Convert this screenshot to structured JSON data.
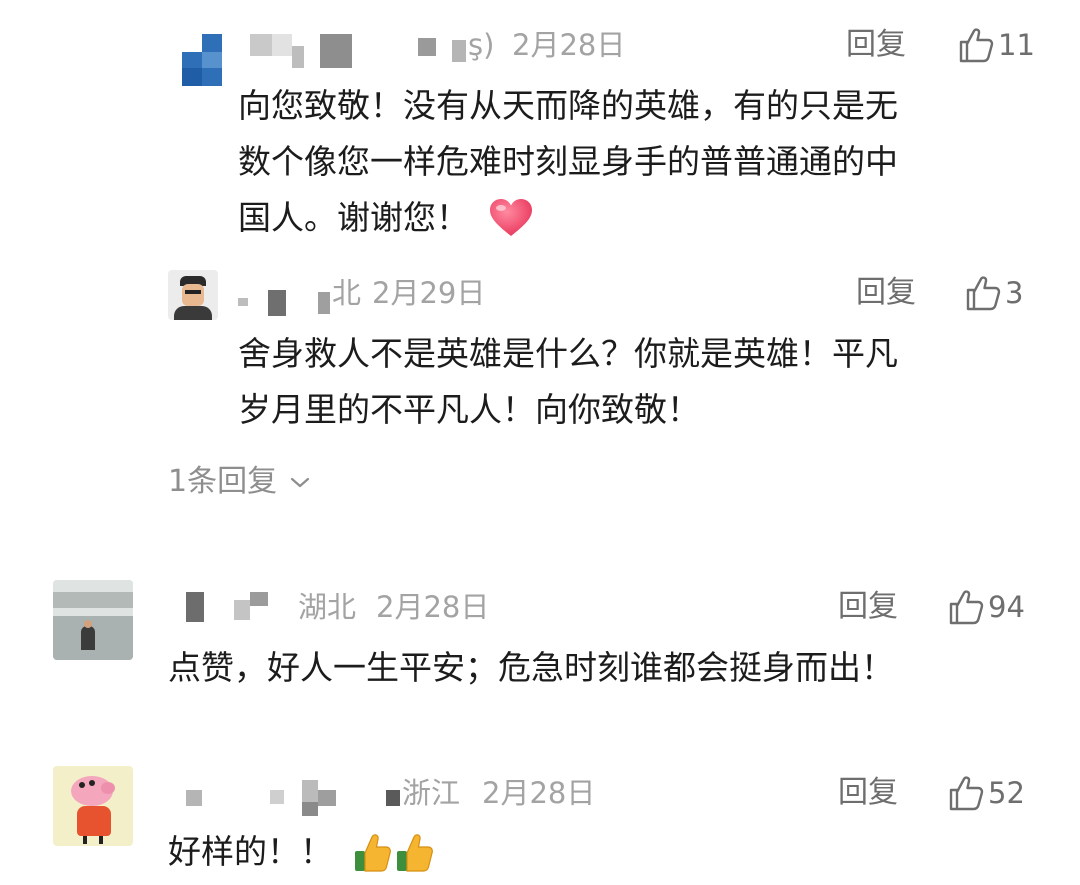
{
  "colors": {
    "text_primary": "#1c1c1c",
    "text_meta": "#a3a3a3",
    "text_action": "#6e6e6e",
    "heart": "#f0536f",
    "thumb_emoji": "#f6b530"
  },
  "comments": [
    {
      "level": "reply",
      "name_partial": "ş)",
      "location": "",
      "date": "2月28日",
      "reply_label": "回复",
      "likes": "11",
      "lines": [
        "向您致敬！没有从天而降的英雄，有的只是无",
        "数个像您一样危难时刻显身手的普普通通的中",
        "国人。谢谢您！"
      ],
      "emoji": "heart-emoji"
    },
    {
      "level": "reply",
      "name_partial": "北",
      "location": "",
      "date": "2月29日",
      "reply_label": "回复",
      "likes": "3",
      "lines": [
        "舍身救人不是英雄是什么？你就是英雄！平凡",
        "岁月里的不平凡人！向你致敬！"
      ]
    },
    {
      "level": "top",
      "name_partial": "",
      "location": "湖北",
      "date": "2月28日",
      "reply_label": "回复",
      "likes": "94",
      "lines": [
        "点赞，好人一生平安；危急时刻谁都会挺身而出！"
      ]
    },
    {
      "level": "top",
      "name_partial": "",
      "location": "浙江",
      "date": "2月28日",
      "reply_label": "回复",
      "likes": "52",
      "lines": [
        "好样的！！"
      ],
      "emoji": "thumbs-up-emoji"
    }
  ],
  "more_replies": {
    "label": "1条回复"
  }
}
